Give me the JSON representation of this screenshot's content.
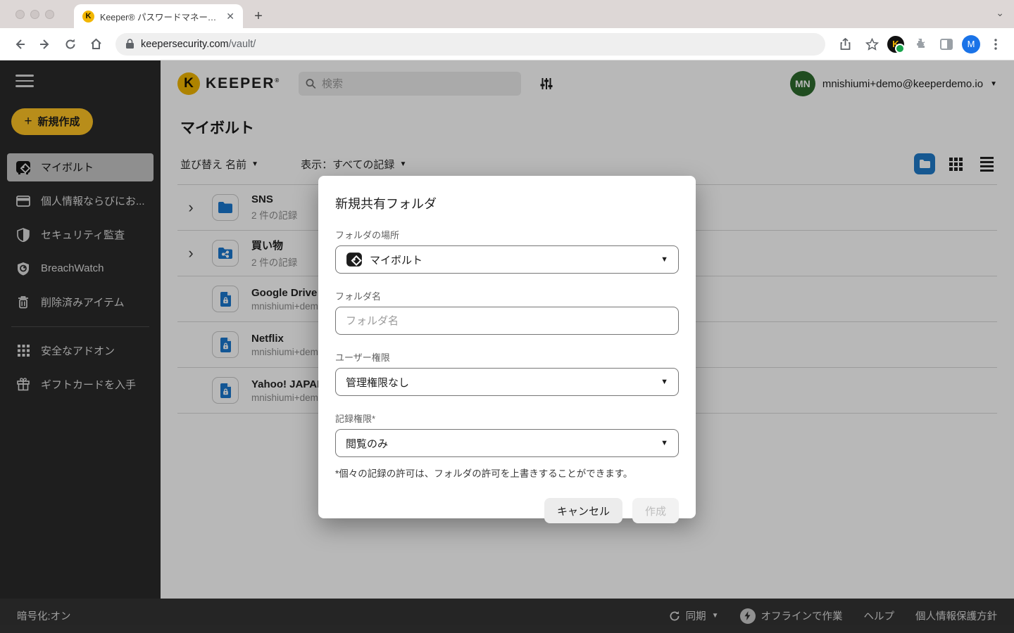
{
  "browser": {
    "tab_title": "Keeper® パスワードマネージャー",
    "url_host": "keepersecurity.com",
    "url_path": "/vault/",
    "profile_initial": "M",
    "favicon_letter": "K"
  },
  "header": {
    "brand": "KEEPER",
    "brand_reg": "®",
    "search_placeholder": "検索",
    "avatar_initials": "MN",
    "account_email": "mnishiumi+demo@keeperdemo.io"
  },
  "sidebar": {
    "new_button": "新規作成",
    "items": [
      {
        "label": "マイボルト"
      },
      {
        "label": "個人情報ならびにお..."
      },
      {
        "label": "セキュリティ監査"
      },
      {
        "label": "BreachWatch"
      },
      {
        "label": "削除済みアイテム"
      },
      {
        "label": "安全なアドオン"
      },
      {
        "label": "ギフトカードを入手"
      }
    ]
  },
  "content": {
    "page_title": "マイボルト",
    "sort_label": "並び替え 名前",
    "view_label": "表示：すべての記録"
  },
  "records": [
    {
      "title": "SNS",
      "subtitle": "2 件の記録"
    },
    {
      "title": "買い物",
      "subtitle": "2 件の記録"
    },
    {
      "title": "Google Drive",
      "subtitle": "mnishiumi+dem"
    },
    {
      "title": "Netflix",
      "subtitle": "mnishiumi+dem"
    },
    {
      "title": "Yahoo! JAPAN",
      "subtitle": "mnishiumi+dem"
    }
  ],
  "modal": {
    "title": "新規共有フォルダ",
    "location_label": "フォルダの場所",
    "location_value": "マイボルト",
    "name_label": "フォルダ名",
    "name_placeholder": "フォルダ名",
    "user_perm_label": "ユーザー権限",
    "user_perm_value": "管理権限なし",
    "record_perm_label": "記録権限*",
    "record_perm_value": "閲覧のみ",
    "note": "*個々の記録の許可は、フォルダの許可を上書きすることができます。",
    "cancel_label": "キャンセル",
    "create_label": "作成"
  },
  "statusbar": {
    "encryption": "暗号化:オン",
    "sync": "同期",
    "offline": "オフラインで作業",
    "help": "ヘルプ",
    "privacy": "個人情報保護方針"
  },
  "colors": {
    "keeper_gold": "#ffc425",
    "record_blue": "#1a78cf",
    "toggle_blue": "#1f7ac9",
    "avatar_green": "#2d6b2d",
    "chrome_profile_blue": "#1a73e8"
  }
}
